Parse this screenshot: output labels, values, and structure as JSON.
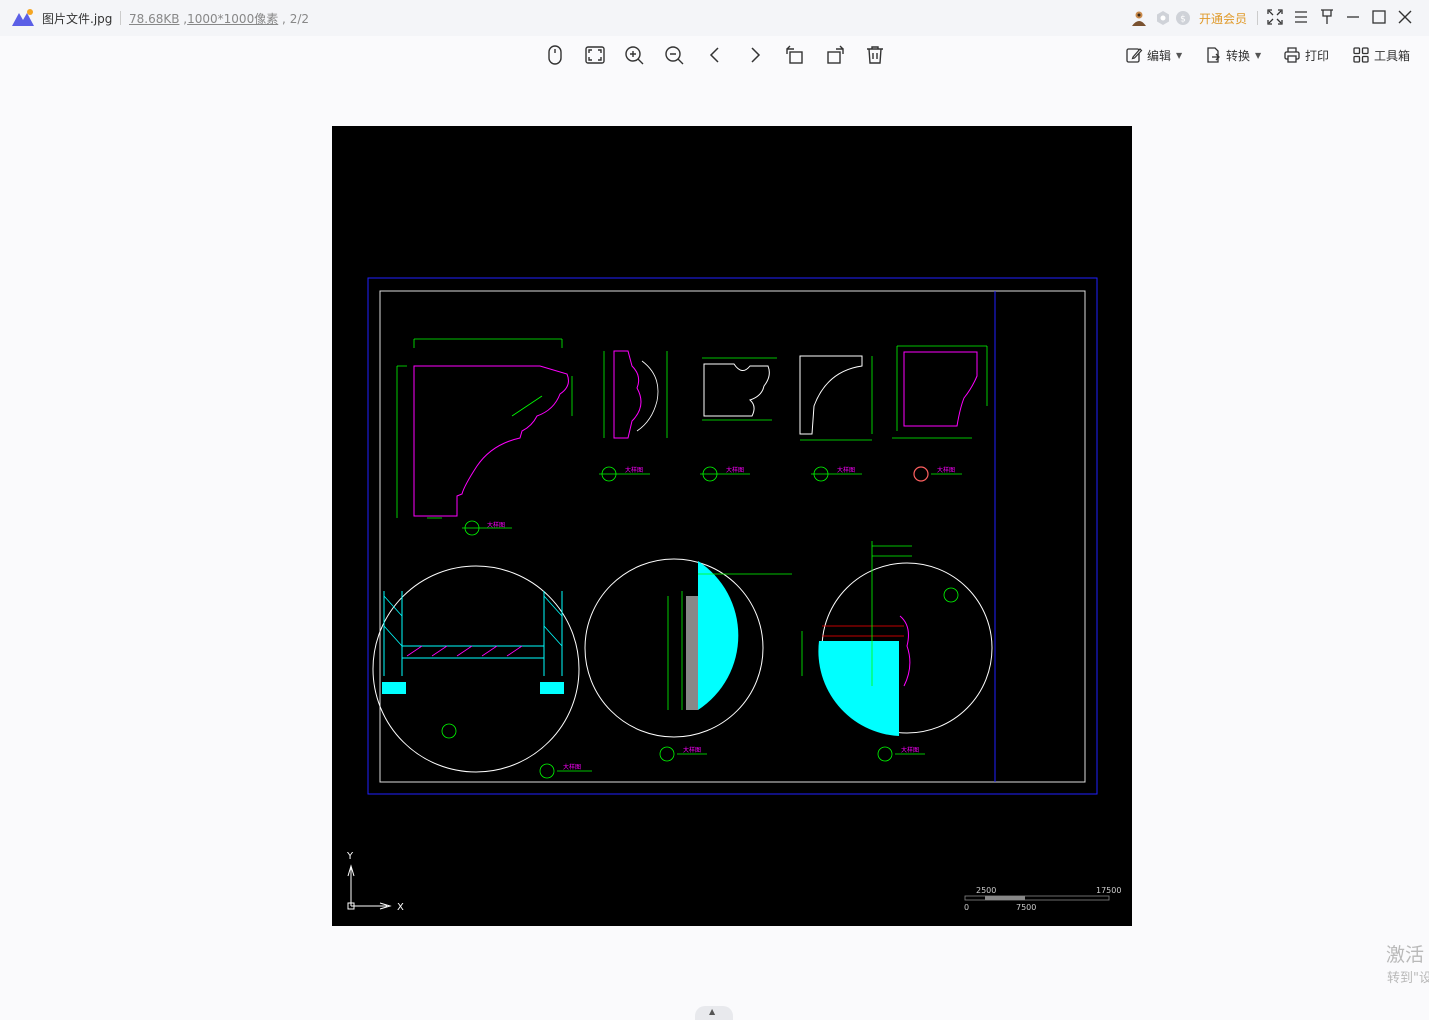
{
  "titlebar": {
    "file_name": "图片文件.jpg",
    "file_size": "78.68KB",
    "dimensions": "1000*1000像素",
    "page_index": "2/2",
    "vip_label": "开通会员"
  },
  "toolbar": {
    "edit_label": "编辑",
    "convert_label": "转换",
    "print_label": "打印",
    "toolbox_label": "工具箱"
  },
  "drawing": {
    "detail_label": "大样图",
    "scale_label": "Scale 1:5",
    "axis_y": "Y",
    "axis_x": "X",
    "scale_bar": {
      "left_top": "2500",
      "right_top": "17500",
      "left_bottom": "0",
      "mid_bottom": "7500"
    }
  },
  "watermark": {
    "line1": "激活",
    "line2": "转到\"设"
  },
  "colors": {
    "accent": "#e09a2a",
    "cad_magenta": "#ff00ff",
    "cad_green": "#00ff00",
    "cad_cyan": "#00ffff",
    "cad_blue": "#0000ff"
  }
}
